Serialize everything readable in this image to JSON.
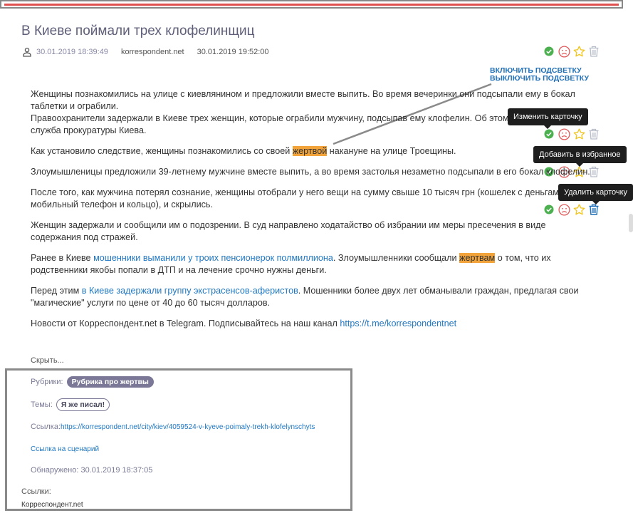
{
  "article": {
    "title": "В Киеве поймали трех клофелинщиц",
    "meta": {
      "published": "30.01.2019 18:39:49",
      "source": "korrespondent.net",
      "collected": "30.01.2019 19:52:00"
    },
    "highlight": {
      "on_label": "ВКЛЮЧИТЬ ПОДСВЕТКУ",
      "off_label": "ВЫКЛЮЧИТЬ ПОДСВЕТКУ"
    },
    "paragraphs": {
      "p1a": "Женщины познакомились на улице с киевлянином и предложили вместе выпить. Во время вечеринки они подсыпали ему в бокал таблетки и ограбили.",
      "p1b": "Правоохранители задержали в Киеве трех женщин, которые ограбили мужчину, подсыпав ему клофелин. Об этом сообщает пресс-служба прокуратуры Киева.",
      "p2_before": "Как установило следствие, женщины познакомились со своей ",
      "p2_mark": "жертвой",
      "p2_after": " накануне на улице Троещины.",
      "p3": "Злоумышленицы предложили 39-летнему мужчине вместе выпить, а во время застолья незаметно подсыпали в его бокал клофелин.",
      "p4": "После того, как мужчина потерял сознание, женщины отобрали у него вещи на сумму свыше 10 тысяч грн (кошелек с деньгами, мобильный телефон и кольцо), и скрылись.",
      "p5": "Женщин задержали и сообщили им о подозрении. В суд направлено ходатайство об избрании им меры пресечения в виде содержания под стражей.",
      "p6_before": "Ранее в Киеве ",
      "p6_link": "мошенники выманили у троих пенсионерок полмиллиона",
      "p6_mid": ". Злоумышленники сообщали ",
      "p6_mark": "жертвам",
      "p6_after": " о том, что их родственники якобы попали в ДТП и на лечение срочно нужны деньги.",
      "p7_before": "Перед этим ",
      "p7_link": "в Киеве задержали группу экстрасенсов-аферистов",
      "p7_after": ". Мошенники более двух лет обманывали граждан, предлагая свои \"магические\" услуги по цене от 40 до 60 тысяч долларов.",
      "p8_before": "Новости от Корреспондент.net в Telegram. Подписывайтесь на наш канал ",
      "p8_link": "https://t.me/korrespondentnet"
    },
    "hide_label": "Скрыть..."
  },
  "tooltips": {
    "edit": "Изменить карточку",
    "favorite": "Добавить в избранное",
    "delete": "Удалить карточку"
  },
  "info": {
    "rubrics_label": "Рубрики:",
    "rubric": "Рубрика про жертвы",
    "themes_label": "Темы:",
    "theme": "Я же писал!",
    "link_label": "Ссылка:",
    "link_url": "https://korrespondent.net/city/kiev/4059524-v-kyeve-poimaly-trekh-klofelynschyts",
    "scenario_link": "Ссылка на сценарий",
    "detected": "Обнаружено: 30.01.2019 18:37:05",
    "links_label": "Ссылки:",
    "links_value": "Корреспондент.net"
  },
  "colors": {
    "check": "#4caf50",
    "sad": "#e05a5a",
    "star": "#f0c419",
    "trash": "#b7bdc9",
    "trash_active": "#1f6fb8",
    "highlight": "#f2a43a",
    "link": "#1f77c2"
  }
}
